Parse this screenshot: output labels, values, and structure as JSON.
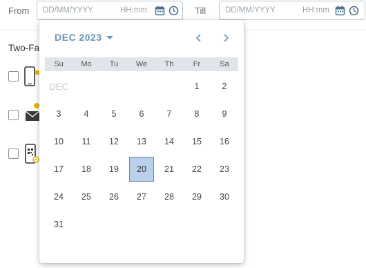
{
  "filter": {
    "from_label": "From",
    "till_label": "Till",
    "from_date_placeholder": "DD/MM/YYYY",
    "from_time_placeholder": "HH:mm",
    "till_date_placeholder": "DD/MM/YYYY",
    "till_time_placeholder": "HH:mm",
    "icons": [
      "calendar-icon",
      "clock-icon"
    ]
  },
  "section": {
    "title": "Two-Fa",
    "methods": [
      {
        "icon": "phone-icon",
        "checked": false
      },
      {
        "icon": "email-icon",
        "checked": false
      },
      {
        "icon": "qr-code-icon",
        "checked": false
      }
    ]
  },
  "calendar": {
    "month_label": "DEC 2023",
    "inline_month": "DEC",
    "weekdays": [
      "Su",
      "Mo",
      "Tu",
      "We",
      "Th",
      "Fr",
      "Sa"
    ],
    "weeks": [
      [
        "DEC",
        "",
        "",
        "",
        "",
        "1",
        "2"
      ],
      [
        "3",
        "4",
        "5",
        "6",
        "7",
        "8",
        "9"
      ],
      [
        "10",
        "11",
        "12",
        "13",
        "14",
        "15",
        "16"
      ],
      [
        "17",
        "18",
        "19",
        "20",
        "21",
        "22",
        "23"
      ],
      [
        "24",
        "25",
        "26",
        "27",
        "28",
        "29",
        "30"
      ],
      [
        "31",
        "",
        "",
        "",
        "",
        "",
        ""
      ]
    ],
    "selected_day": "20",
    "colors": {
      "accent": "#6a93b8",
      "selected_bg": "#b9d1ea",
      "header_bg": "#dfe5ea",
      "icon_yellow": "#e6b800"
    },
    "nav_icons": [
      "chevron-left-icon",
      "chevron-right-icon"
    ]
  }
}
